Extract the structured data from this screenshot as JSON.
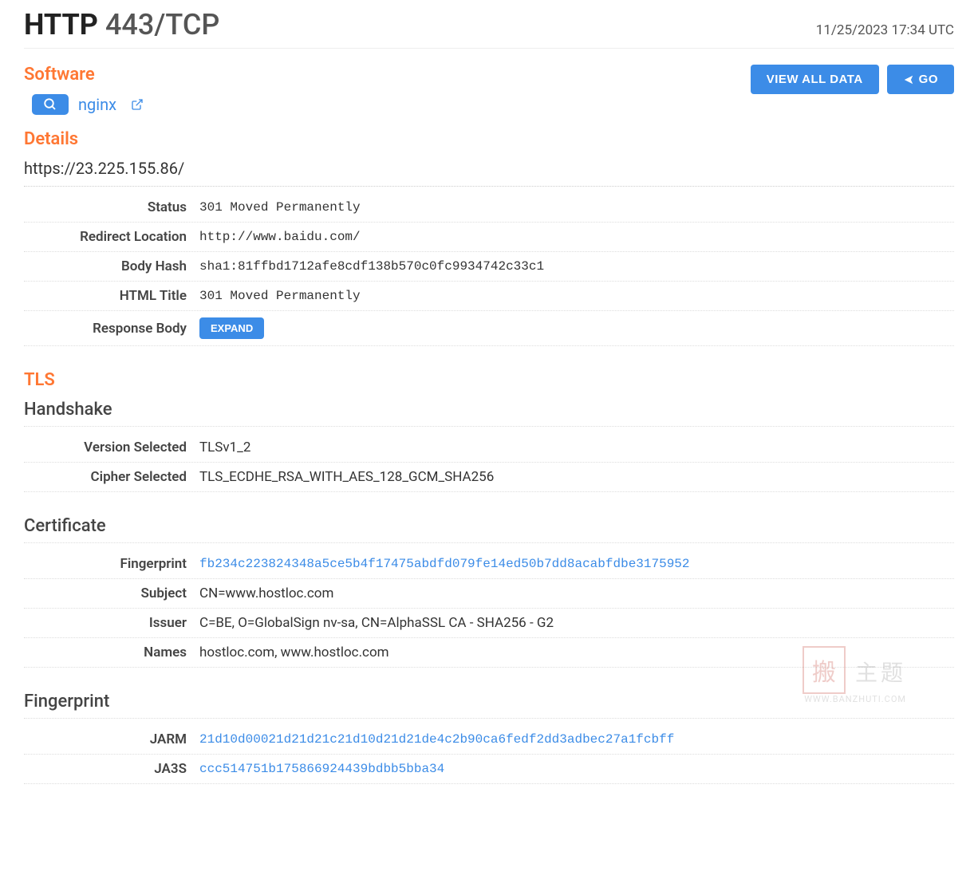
{
  "header": {
    "protocol": "HTTP",
    "port_transport": "443/TCP",
    "timestamp": "11/25/2023 17:34 UTC"
  },
  "buttons": {
    "view_all": "VIEW ALL DATA",
    "go": "GO",
    "expand": "EXPAND"
  },
  "software": {
    "title": "Software",
    "name": "nginx"
  },
  "details": {
    "title": "Details",
    "url": "https://23.225.155.86/",
    "rows": {
      "status_key": "Status",
      "status_val": "301 Moved Permanently",
      "redirect_key": "Redirect Location",
      "redirect_val": "http://www.baidu.com/",
      "bodyhash_key": "Body Hash",
      "bodyhash_val": "sha1:81ffbd1712afe8cdf138b570c0fc9934742c33c1",
      "htmltitle_key": "HTML Title",
      "htmltitle_val": "301 Moved Permanently",
      "respbody_key": "Response Body"
    }
  },
  "tls": {
    "title": "TLS",
    "handshake_title": "Handshake",
    "version_key": "Version Selected",
    "version_val": "TLSv1_2",
    "cipher_key": "Cipher Selected",
    "cipher_val": "TLS_ECDHE_RSA_WITH_AES_128_GCM_SHA256",
    "cert_title": "Certificate",
    "fp_key": "Fingerprint",
    "fp_val": "fb234c223824348a5ce5b4f17475abdfd079fe14ed50b7dd8acabfdbe3175952",
    "subject_key": "Subject",
    "subject_val": "CN=www.hostloc.com",
    "issuer_key": "Issuer",
    "issuer_val": "C=BE, O=GlobalSign nv-sa, CN=AlphaSSL CA - SHA256 - G2",
    "names_key": "Names",
    "names_val": "hostloc.com, www.hostloc.com",
    "fp2_title": "Fingerprint",
    "jarm_key": "JARM",
    "jarm_val": "21d10d00021d21d21c21d10d21d21de4c2b90ca6fedf2dd3adbec27a1fcbff",
    "ja3s_key": "JA3S",
    "ja3s_val": "ccc514751b175866924439bdbb5bba34"
  },
  "watermark": {
    "stamp": "搬",
    "text": "主题",
    "url": "WWW.BANZHUTI.COM"
  }
}
